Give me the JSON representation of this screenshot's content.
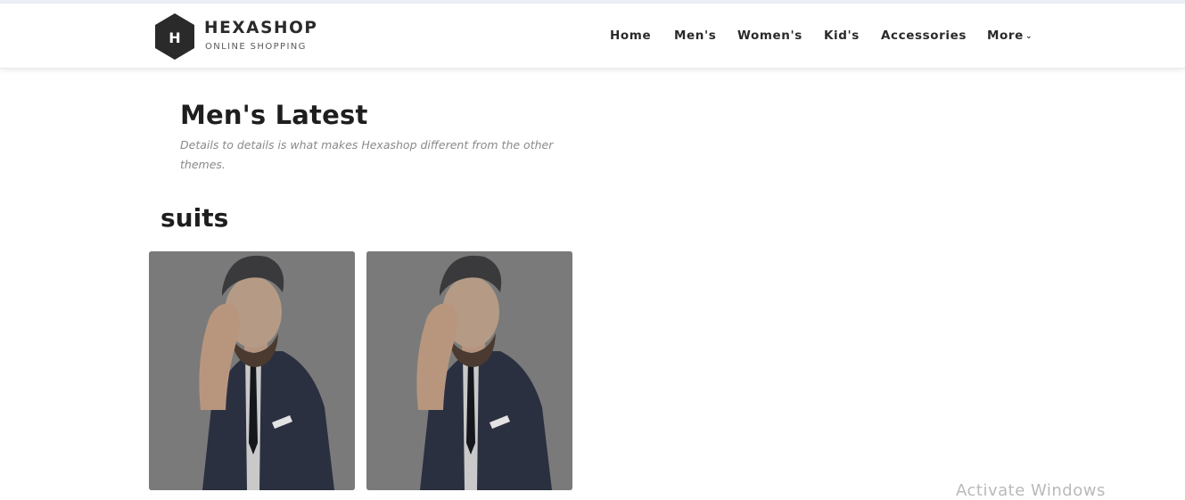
{
  "header": {
    "brand": "HEXASHOP",
    "tagline": "ONLINE SHOPPING",
    "logo_letter": "H",
    "nav": [
      {
        "label": "Home"
      },
      {
        "label": "Men's"
      },
      {
        "label": "Women's"
      },
      {
        "label": "Kid's"
      },
      {
        "label": "Accessories"
      },
      {
        "label": "More",
        "icon": "chevron-down-icon"
      }
    ]
  },
  "main": {
    "title": "Men's Latest",
    "subtitle": "Details to details is what makes Hexashop different from the other themes.",
    "section_title": "suits",
    "products": [
      {
        "image": "man-in-suit-photo"
      },
      {
        "image": "man-in-suit-photo"
      }
    ]
  },
  "watermark": "Activate Windows",
  "colors": {
    "text_dark": "#2a2a2a",
    "subtitle_gray": "#8a8a8a",
    "logo_hex": "#2a2a2a",
    "card_overlay": "#7a7a7a",
    "suit_navy": "#2b3040"
  }
}
